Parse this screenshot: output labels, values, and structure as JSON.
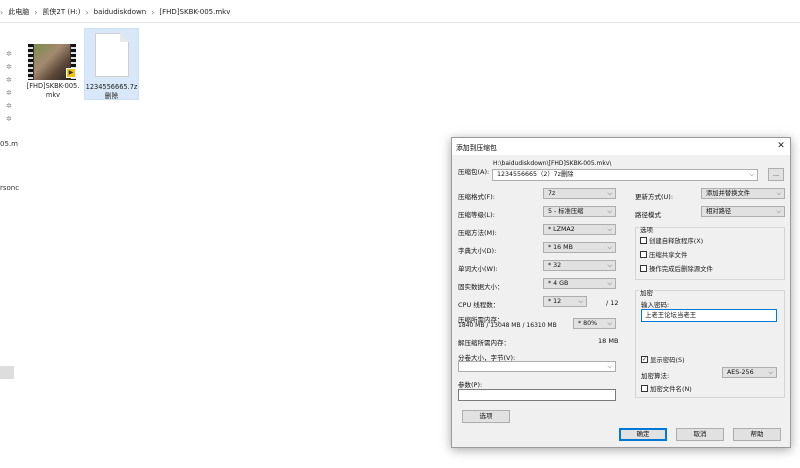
{
  "explorer": {
    "breadcrumb": [
      "此电脑",
      "凯侠2T (H:)",
      "baidudiskdown",
      "[FHD]SKBK-005.mkv"
    ],
    "left_cut_1": "05.m",
    "left_cut_2": "rsonc",
    "pin_glyph": "✲",
    "files": [
      {
        "name_line1": "[FHD]SKBK-005.",
        "name_line2": "mkv",
        "icon": "video-file-icon"
      },
      {
        "name_line1": "1234556665.7z",
        "name_line2": "删除",
        "icon": "blank-document-icon"
      }
    ]
  },
  "dialog": {
    "title": "添加到压缩包",
    "archive_label": "压缩包(A):",
    "archive_path": "H:\\baidudiskdown\\[FHD]SKBK-005.mkv\\",
    "archive_name": "1234556665（2）7z删除",
    "browse_label": "...",
    "format_label": "压缩格式(F):",
    "format_value": "7z",
    "level_label": "压缩等级(L):",
    "level_value": "5 - 标准压缩",
    "method_label": "压缩方法(M):",
    "method_value": "* LZMA2",
    "dict_label": "字典大小(D):",
    "dict_value": "* 16 MB",
    "word_label": "单词大小(W):",
    "word_value": "* 32",
    "solid_label": "固实数据大小：",
    "solid_value": "* 4 GB",
    "cpu_label": "CPU 线程数：",
    "cpu_value": "* 12",
    "cpu_max": "/ 12",
    "mem_label": "压缩所需内存：",
    "mem_detail": "1840 MB / 13048 MB / 16310 MB",
    "mem_pct": "* 80%",
    "decomp_label": "解压缩所需内存：",
    "decomp_value": "18 MB",
    "split_label": "分卷大小，字节(V):",
    "split_value": "",
    "params_label": "参数(P):",
    "params_value": "",
    "options_button": "选项",
    "update_label": "更新方式(U):",
    "update_value": "添加并替换文件",
    "path_label": "路径模式",
    "path_value": "相对路径",
    "options_group": "选项",
    "opt_sfx": "创建自释放程序(X)",
    "opt_shared": "压缩共享文件",
    "opt_delete": "操作完成后删除源文件",
    "encrypt_group": "加密",
    "pwd_label": "输入密码:",
    "pwd_value": "上老王论坛当老王",
    "show_pwd": "显示密码(S)",
    "show_pwd_checked": true,
    "enc_method_label": "加密算法:",
    "enc_method_value": "AES-256",
    "encrypt_names": "加密文件名(N)",
    "ok_button": "确定",
    "cancel_button": "取消",
    "help_button": "帮助"
  }
}
